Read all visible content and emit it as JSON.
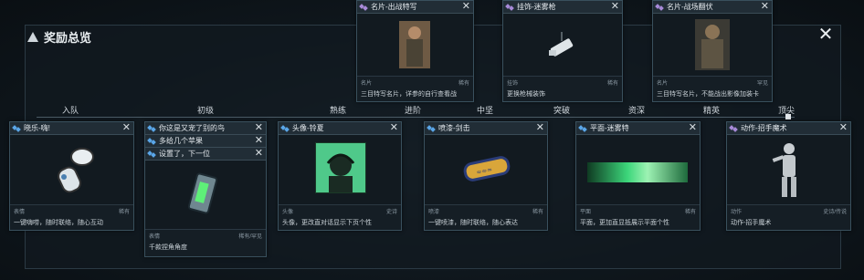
{
  "panel_title": "奖励总览",
  "stages": [
    "入队",
    "初级",
    "熟练",
    "进阶",
    "中坚",
    "突破",
    "资深",
    "精英",
    "顶尖"
  ],
  "cards": {
    "c1": {
      "title": "晓乐-嗨!",
      "type": "表情",
      "rarity": "稀有",
      "desc": "一键嗨唠，随时联络，随心互动"
    },
    "c2a": {
      "title": "你这是又宠了别的鸟"
    },
    "c2b": {
      "title": "多给几个苹果"
    },
    "c2c": {
      "title": "设置了，下一位",
      "type": "表情",
      "rarity": "稀有/罕见",
      "desc": "千款捏角角度"
    },
    "c3": {
      "title": "头像-铃夏",
      "type": "头像",
      "rarity": "史诗",
      "desc": "头像，更改直对话显示下页个性"
    },
    "c4": {
      "title": "喷漆-剑击",
      "type": "喷漆",
      "rarity": "稀有",
      "desc": "一键喷漆，随时联络，随心表达"
    },
    "c5": {
      "title": "平面-迷雾特",
      "type": "平面",
      "rarity": "稀有",
      "desc": "平面，更加直显抵展示平面个性"
    },
    "c6": {
      "title": "动作-招手魔术",
      "type": "动作",
      "rarity": "史诗/传说",
      "desc": "动作-招手魔术"
    },
    "top1": {
      "title": "名片-出战特写",
      "type": "名片",
      "rarity": "稀有",
      "desc": "三目特写名片，详参的自行查看战"
    },
    "top2": {
      "title": "挂饰-迷雾枪",
      "type": "挂饰",
      "rarity": "稀有",
      "desc": "更换枪械装饰"
    },
    "top3": {
      "title": "名片-战场翻伏",
      "type": "名片",
      "rarity": "罕见",
      "desc": "三目特写名片，不能战出影像加装卡"
    }
  }
}
